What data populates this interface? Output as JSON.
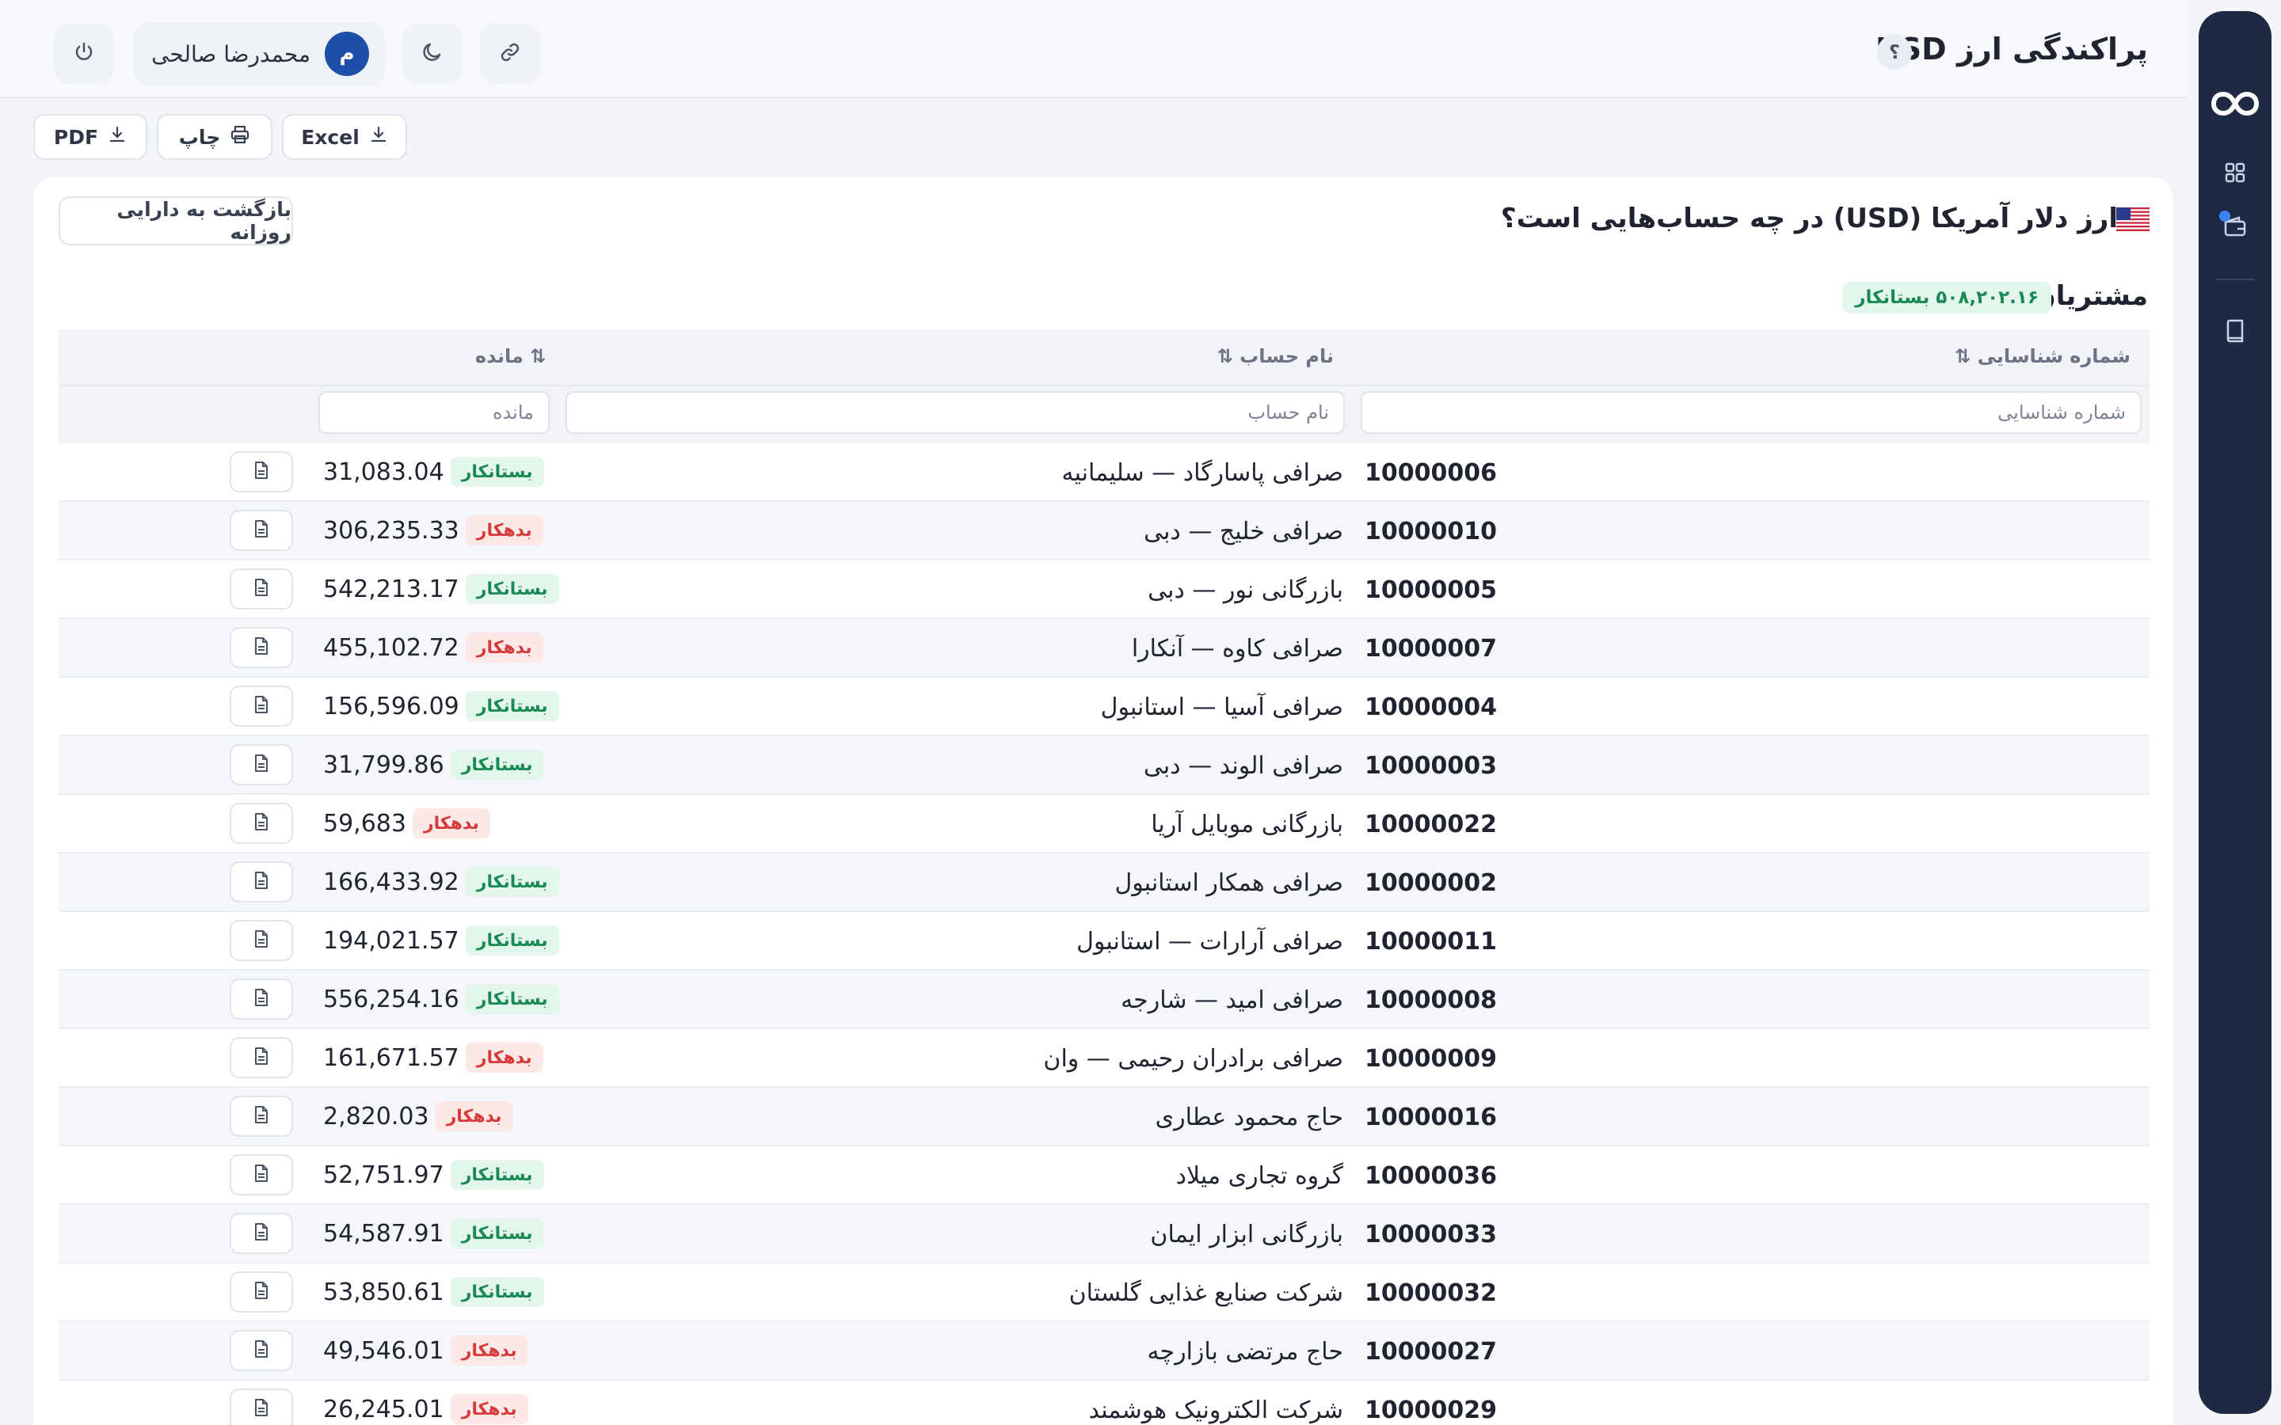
{
  "header": {
    "title": "پراکندگی ارز USD",
    "help_label": "؟",
    "user": {
      "initial": "م",
      "name": "محمدرضا صالحی"
    }
  },
  "toolbar": {
    "excel_label": "Excel",
    "print_label": "چاپ",
    "pdf_label": "PDF"
  },
  "card": {
    "title": "ارز دلار آمریکا (USD) در چه حساب‌هایی است؟",
    "back_label": "بازگشت به دارایی روزانه"
  },
  "section": {
    "title": "مشتریان",
    "total": "۵۰۸,۲۰۲.۱۶ بستانکار"
  },
  "table": {
    "columns": {
      "id": "شماره شناسایی ⇅",
      "name": "نام حساب ⇅",
      "balance": "⇅ مانده"
    },
    "filters": {
      "id": "شماره شناسایی",
      "name": "نام حساب",
      "balance": "مانده"
    },
    "rows": [
      {
        "id": "10000006",
        "name": "صرافی پاسارگاد — سلیمانیه",
        "amount": "31,083.04",
        "status": "بستانکار",
        "type": "credit"
      },
      {
        "id": "10000010",
        "name": "صرافی خلیج — دبی",
        "amount": "306,235.33",
        "status": "بدهکار",
        "type": "debit"
      },
      {
        "id": "10000005",
        "name": "بازرگانی نور — دبی",
        "amount": "542,213.17",
        "status": "بستانکار",
        "type": "credit"
      },
      {
        "id": "10000007",
        "name": "صرافی کاوه — آنکارا",
        "amount": "455,102.72",
        "status": "بدهکار",
        "type": "debit"
      },
      {
        "id": "10000004",
        "name": "صرافی آسیا — استانبول",
        "amount": "156,596.09",
        "status": "بستانکار",
        "type": "credit"
      },
      {
        "id": "10000003",
        "name": "صرافی الوند — دبی",
        "amount": "31,799.86",
        "status": "بستانکار",
        "type": "credit"
      },
      {
        "id": "10000022",
        "name": "بازرگانی موبایل آریا",
        "amount": "59,683",
        "status": "بدهکار",
        "type": "debit"
      },
      {
        "id": "10000002",
        "name": "صرافی همکار استانبول",
        "amount": "166,433.92",
        "status": "بستانکار",
        "type": "credit"
      },
      {
        "id": "10000011",
        "name": "صرافی آرارات — استانبول",
        "amount": "194,021.57",
        "status": "بستانکار",
        "type": "credit"
      },
      {
        "id": "10000008",
        "name": "صرافی امید — شارجه",
        "amount": "556,254.16",
        "status": "بستانکار",
        "type": "credit"
      },
      {
        "id": "10000009",
        "name": "صرافی برادران رحیمی — وان",
        "amount": "161,671.57",
        "status": "بدهکار",
        "type": "debit"
      },
      {
        "id": "10000016",
        "name": "حاج محمود عطاری",
        "amount": "2,820.03",
        "status": "بدهکار",
        "type": "debit"
      },
      {
        "id": "10000036",
        "name": "گروه تجاری میلاد",
        "amount": "52,751.97",
        "status": "بستانکار",
        "type": "credit"
      },
      {
        "id": "10000033",
        "name": "بازرگانی ابزار ایمان",
        "amount": "54,587.91",
        "status": "بستانکار",
        "type": "credit"
      },
      {
        "id": "10000032",
        "name": "شرکت صنایع غذایی گلستان",
        "amount": "53,850.61",
        "status": "بستانکار",
        "type": "credit"
      },
      {
        "id": "10000027",
        "name": "حاج مرتضی بازارچه",
        "amount": "49,546.01",
        "status": "بدهکار",
        "type": "debit"
      },
      {
        "id": "10000029",
        "name": "شرکت الکترونیک هوشمند",
        "amount": "26,245.01",
        "status": "بدهکار",
        "type": "debit"
      }
    ]
  },
  "colors": {
    "sidebar": "#1e2a44",
    "credit": "#1a8a55",
    "debit": "#d63a3a",
    "accent": "#3b82f6"
  },
  "icons": [
    "infinity-logo-icon",
    "dashboard-grid-icon",
    "wallet-icon",
    "book-icon",
    "power-icon",
    "moon-icon",
    "link-icon",
    "download-icon",
    "printer-icon",
    "document-icon",
    "us-flag-icon"
  ]
}
